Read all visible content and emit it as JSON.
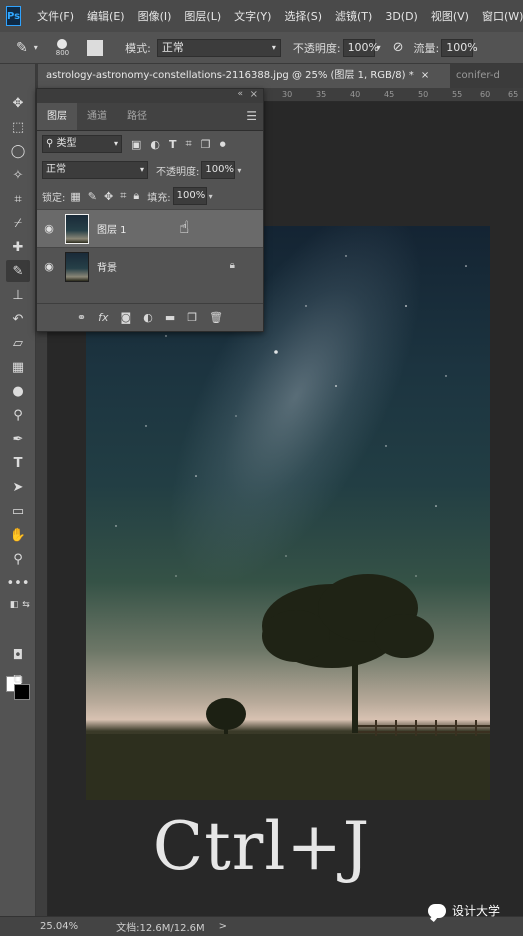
{
  "app": {
    "logo": "Ps"
  },
  "menu": [
    "文件(F)",
    "编辑(E)",
    "图像(I)",
    "图层(L)",
    "文字(Y)",
    "选择(S)",
    "滤镜(T)",
    "3D(D)",
    "视图(V)",
    "窗口(W)"
  ],
  "options": {
    "brush_size": "800",
    "mode_label": "模式:",
    "mode_value": "正常",
    "opacity_label": "不透明度:",
    "opacity_value": "100%",
    "flow_label": "流量:",
    "flow_value": "100%"
  },
  "tabs": {
    "active": "astrology-astronomy-constellations-2116388.jpg @ 25% (图层 1, RGB/8) *",
    "close": "×",
    "other": "conifer-d"
  },
  "ruler": {
    "ticks": [
      "30",
      "35",
      "40",
      "45",
      "50",
      "55",
      "60",
      "65"
    ]
  },
  "layers_panel": {
    "collapse": "«",
    "close": "×",
    "tabs": [
      "图层",
      "通道",
      "路径"
    ],
    "filter_kind": "类型",
    "blend_mode": "正常",
    "opacity_label": "不透明度:",
    "opacity_value": "100%",
    "lock_label": "锁定:",
    "fill_label": "填充:",
    "fill_value": "100%",
    "layers": [
      {
        "name": "图层 1",
        "selected": true
      },
      {
        "name": "背景",
        "selected": false,
        "locked": true
      }
    ],
    "footer_icons": [
      "link-icon",
      "fx-icon",
      "mask-icon",
      "adjustment-icon",
      "folder-icon",
      "new-layer-icon",
      "trash-icon"
    ]
  },
  "overlay": {
    "shortcut": "Ctrl+J"
  },
  "status": {
    "zoom": "25.04%",
    "doc": "文档:12.6M/12.6M",
    "arrow": ">"
  },
  "watermark": {
    "text": "设计大学"
  },
  "colors": {
    "foreground": "#ffffff",
    "background": "#000000",
    "accent": "#31a8ff"
  }
}
